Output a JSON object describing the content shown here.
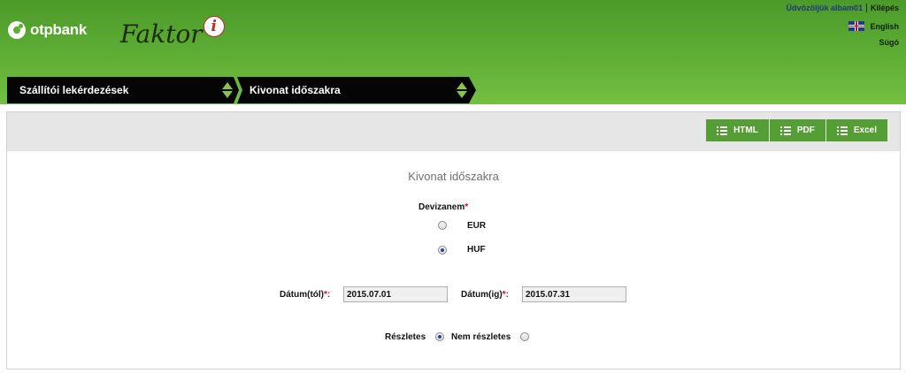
{
  "header": {
    "brand": "otpbank",
    "app_name": "Faktor",
    "app_badge": "i",
    "welcome_text": "Üdvözöljük albam01",
    "logout_label": "Kilépés",
    "language_label": "English",
    "help_label": "Súgó"
  },
  "nav": {
    "items": [
      {
        "label": "Szállítói lekérdezések"
      },
      {
        "label": "Kivonat időszakra"
      }
    ]
  },
  "toolbar": {
    "export_html": "HTML",
    "export_pdf": "PDF",
    "export_excel": "Excel"
  },
  "form": {
    "title": "Kivonat időszakra",
    "currency_label": "Devizanem",
    "required_mark": "*",
    "currency_options": [
      {
        "label": "EUR",
        "checked": false
      },
      {
        "label": "HUF",
        "checked": true
      }
    ],
    "date_from_label": "Dátum(tól)",
    "date_from_value": "2015.07.01",
    "date_to_label": "Dátum(ig)",
    "date_to_value": "2015.07.31",
    "label_suffix": ":",
    "detail_options": [
      {
        "label": "Részletes",
        "checked": true
      },
      {
        "label": "Nem részletes",
        "checked": false
      }
    ]
  },
  "colors": {
    "header_green": "#5fae34",
    "export_green": "#559e36",
    "nav_black": "#050505",
    "required_red": "#c8102e"
  }
}
